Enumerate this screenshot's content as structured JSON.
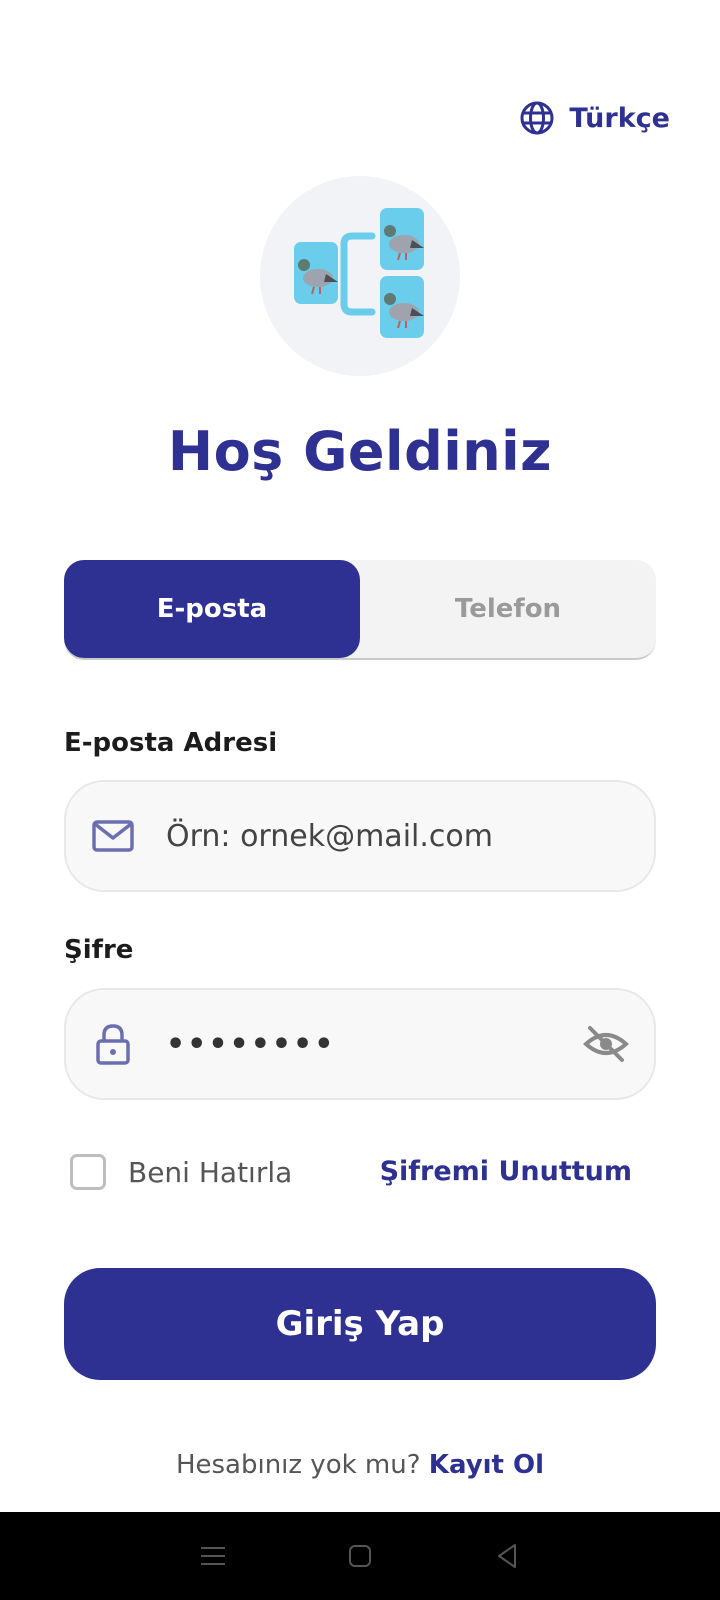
{
  "language": {
    "label": "Türkçe",
    "icon": "globe-icon"
  },
  "logo": {
    "icon": "pigeon-pedigree-logo"
  },
  "title": "Hoş Geldiniz",
  "tabs": [
    {
      "label": "E-posta",
      "active": true
    },
    {
      "label": "Telefon",
      "active": false
    }
  ],
  "email": {
    "label": "E-posta Adresi",
    "placeholder": "Örn: ornek@mail.com",
    "icon": "mail-icon"
  },
  "password": {
    "label": "Şifre",
    "value": "••••••••",
    "icon": "lock-icon",
    "toggle_icon": "eye-off-icon"
  },
  "remember": {
    "label": "Beni Hatırla",
    "checked": false
  },
  "forgot_label": "Şifremi Unuttum",
  "login_label": "Giriş Yap",
  "signup": {
    "prompt": "Hesabınız yok mu?",
    "link": "Kayıt Ol"
  },
  "colors": {
    "primary": "#2E3192",
    "accent": "#6ACDEB"
  }
}
